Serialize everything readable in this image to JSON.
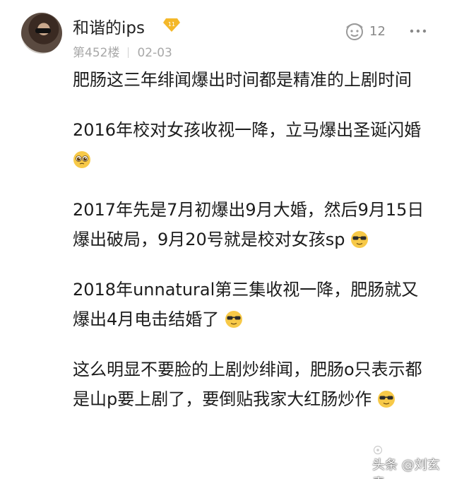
{
  "post": {
    "username": "和谐的ips",
    "level": "11",
    "floor": "第452楼",
    "date": "02-03",
    "like_count": "12",
    "paragraphs": [
      "肥肠这三年绯闻爆出时间都是精准的上剧时间",
      "2016年校对女孩收视一降，立马爆出圣诞闪婚",
      "2017年先是7月初爆出9月大婚，然后9月15日爆出破局，9月20号就是校对女孩sp",
      "2018年unnatural第三集收视一降，肥肠就又爆出4月电击结婚了",
      "这么明显不要脸的上剧炒绯闻，肥肠o只表示都是山p要上剧了，要倒贴我家大红肠炒作"
    ],
    "emojis": [
      "pleading-emoji",
      "sunglasses-emoji",
      "sunglasses-emoji",
      "sunglasses-emoji"
    ]
  },
  "watermark": {
    "text": "头条 @刘玄青"
  },
  "colors": {
    "badge": "#f4b82a",
    "meta_text": "#a8a8a8",
    "body_text": "#1c1c1c"
  }
}
